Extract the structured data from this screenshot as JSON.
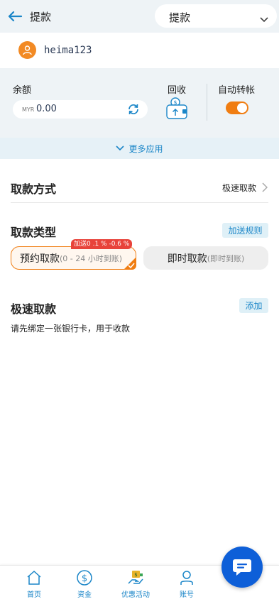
{
  "header": {
    "title": "提款",
    "select_value": "提款"
  },
  "user": {
    "username": "heima123"
  },
  "wallet": {
    "balance_label": "余额",
    "currency": "MYR",
    "balance": "0.00",
    "recycle_label": "回收",
    "auto_transfer_label": "自动转帐",
    "auto_transfer_on": true
  },
  "more_apps": "更多应用",
  "withdraw_method": {
    "title": "取款方式",
    "value": "极速取款"
  },
  "withdraw_type": {
    "title": "取款类型",
    "rules_button": "加送规则",
    "options": [
      {
        "label": "预约取款",
        "sub": "(0 - 24 小时到账)",
        "badge": "加送0 .1 % -0.6 %",
        "selected": true
      },
      {
        "label": "即时取款",
        "sub": "(即时到账)",
        "selected": false
      }
    ]
  },
  "fast_withdraw": {
    "title": "极速取款",
    "add_button": "添加",
    "hint": "请先绑定一张银行卡，用于收款"
  },
  "tabbar": {
    "items": [
      {
        "label": "首页",
        "icon": "home-icon"
      },
      {
        "label": "资金",
        "icon": "dollar-icon"
      },
      {
        "label": "优惠活动",
        "icon": "gift-icon"
      },
      {
        "label": "账号",
        "icon": "user-icon"
      }
    ]
  },
  "colors": {
    "accent": "#1b86c8",
    "orange": "#f07d12",
    "fab": "#0e5fd8",
    "badge": "#e8433a"
  }
}
